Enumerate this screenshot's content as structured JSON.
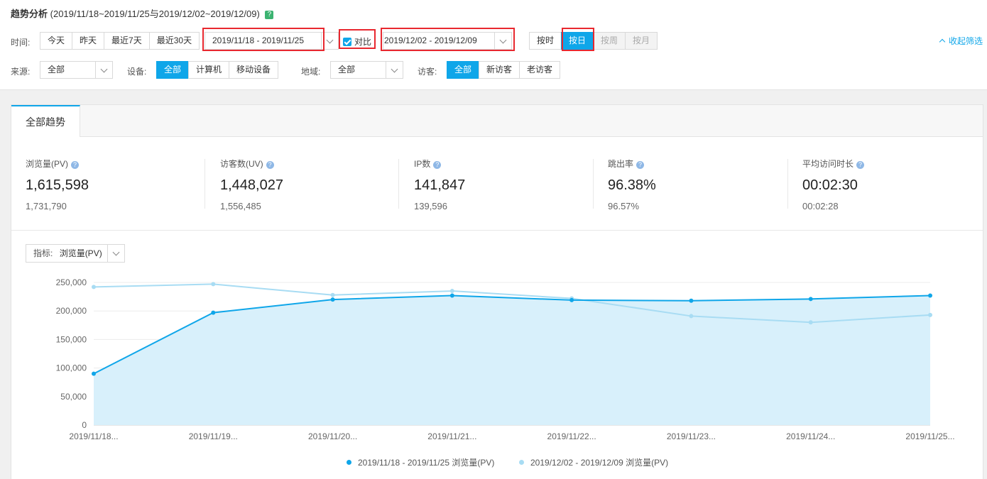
{
  "header": {
    "title": "趋势分析",
    "range_text": "(2019/11/18~2019/11/25与2019/12/02~2019/12/09)",
    "help_icon": "question-icon-green"
  },
  "time_filter": {
    "label": "时间:",
    "quick_ranges": [
      "今天",
      "昨天",
      "最近7天",
      "最近30天"
    ],
    "date_range": "2019/11/18 - 2019/11/25",
    "compare_label": "对比",
    "compare_checked": true,
    "compare_range": "2019/12/02 - 2019/12/09",
    "granularity": [
      "按时",
      "按日",
      "按周",
      "按月"
    ],
    "granularity_active": "按日",
    "collapse_label": "收起筛选"
  },
  "source_filter": {
    "label": "来源:",
    "value": "全部"
  },
  "device_filter": {
    "label": "设备:",
    "options": [
      "全部",
      "计算机",
      "移动设备"
    ],
    "active": "全部"
  },
  "region_filter": {
    "label": "地域:",
    "value": "全部"
  },
  "visitor_filter": {
    "label": "访客:",
    "options": [
      "全部",
      "新访客",
      "老访客"
    ],
    "active": "全部"
  },
  "tabs": {
    "overview": "全部趋势"
  },
  "metrics": [
    {
      "label": "浏览量(PV)",
      "value": "1,615,598",
      "compare": "1,731,790"
    },
    {
      "label": "访客数(UV)",
      "value": "1,448,027",
      "compare": "1,556,485"
    },
    {
      "label": "IP数",
      "value": "141,847",
      "compare": "139,596"
    },
    {
      "label": "跳出率",
      "value": "96.38%",
      "compare": "96.57%"
    },
    {
      "label": "平均访问时长",
      "value": "00:02:30",
      "compare": "00:02:28"
    }
  ],
  "indicator": {
    "label": "指标:",
    "value": "浏览量(PV)"
  },
  "colors": {
    "primary": "#0fa6e9",
    "compare": "#a8dcf3",
    "area": "#d8f0fb"
  },
  "chart_data": {
    "type": "area",
    "categories": [
      "2019/11/18...",
      "2019/11/19...",
      "2019/11/20...",
      "2019/11/21...",
      "2019/11/22...",
      "2019/11/23...",
      "2019/11/24...",
      "2019/11/25..."
    ],
    "ylim": [
      0,
      250000
    ],
    "yticks": [
      "250,000",
      "200,000",
      "150,000",
      "100,000",
      "50,000",
      "0"
    ],
    "ytick_values": [
      250000,
      200000,
      150000,
      100000,
      50000,
      0
    ],
    "grid": true,
    "legend_position": "bottom",
    "series": [
      {
        "name": "2019/11/18 - 2019/11/25 浏览量(PV)",
        "values": [
          90000,
          197000,
          220000,
          227000,
          219000,
          218000,
          221000,
          227000
        ]
      },
      {
        "name": "2019/12/02 - 2019/12/09 浏览量(PV)",
        "values": [
          242000,
          247000,
          228000,
          235000,
          222000,
          191000,
          180000,
          193000
        ]
      }
    ]
  }
}
